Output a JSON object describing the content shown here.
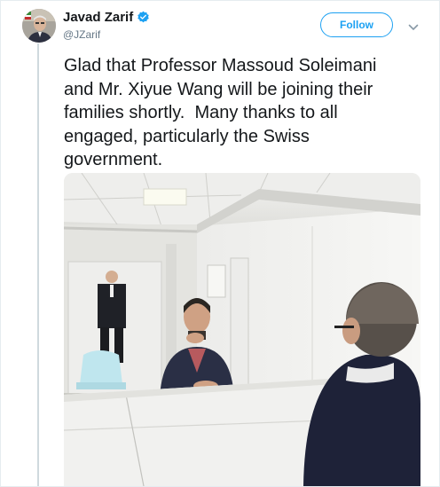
{
  "tweet": {
    "author": {
      "display_name": "Javad Zarif",
      "handle": "@JZarif",
      "verified": true
    },
    "follow_label": "Follow",
    "text": "Glad that Professor Massoud Soleimani\nand Mr. Xiyue Wang will be joining their\nfamilies shortly.  Many thanks to all\nengaged, particularly the Swiss\ngovernment.",
    "icons": {
      "verified": "verified-badge-icon",
      "more": "chevron-down-icon"
    },
    "colors": {
      "accent": "#1da1f2",
      "text": "#14171a",
      "secondary": "#657786"
    }
  }
}
